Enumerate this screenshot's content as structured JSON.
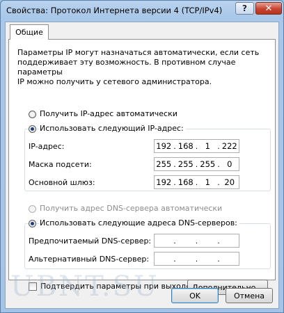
{
  "window": {
    "title": "Свойства: Протокол Интернета версии 4 (TCP/IPv4)",
    "help_glyph": "?",
    "close_glyph": "✕"
  },
  "tabs": [
    {
      "label": "Общие",
      "active": true
    }
  ],
  "description": "Параметры IP могут назначаться автоматически, если сеть\nподдерживает эту возможность. В противном случае параметры\nIP можно получить у сетевого администратора.",
  "ip_section": {
    "auto_label": "Получить IP-адрес автоматически",
    "manual_label": "Использовать следующий IP-адрес:",
    "selected": "manual",
    "fields": [
      {
        "label": "IP-адрес:",
        "value": [
          "192",
          "168",
          "1",
          "222"
        ]
      },
      {
        "label": "Маска подсети:",
        "value": [
          "255",
          "255",
          "255",
          "0"
        ]
      },
      {
        "label": "Основной шлюз:",
        "value": [
          "192",
          "168",
          "1",
          "20"
        ]
      }
    ]
  },
  "dns_section": {
    "auto_label": "Получить адрес DNS-сервера автоматически",
    "auto_disabled": true,
    "manual_label": "Использовать следующие адреса DNS-серверов:",
    "selected": "manual",
    "fields": [
      {
        "label": "Предпочитаемый DNS-сервер:",
        "value": [
          "",
          "",
          "",
          ""
        ]
      },
      {
        "label": "Альтернативный DNS-сервер:",
        "value": [
          "",
          "",
          "",
          ""
        ]
      }
    ]
  },
  "validate_label": "Подтвердить параметры при выходе",
  "validate_checked": false,
  "advanced_label": "Дополнительно...",
  "ok_label": "OK",
  "cancel_label": "Отмена",
  "watermark": "UBNT.SU"
}
